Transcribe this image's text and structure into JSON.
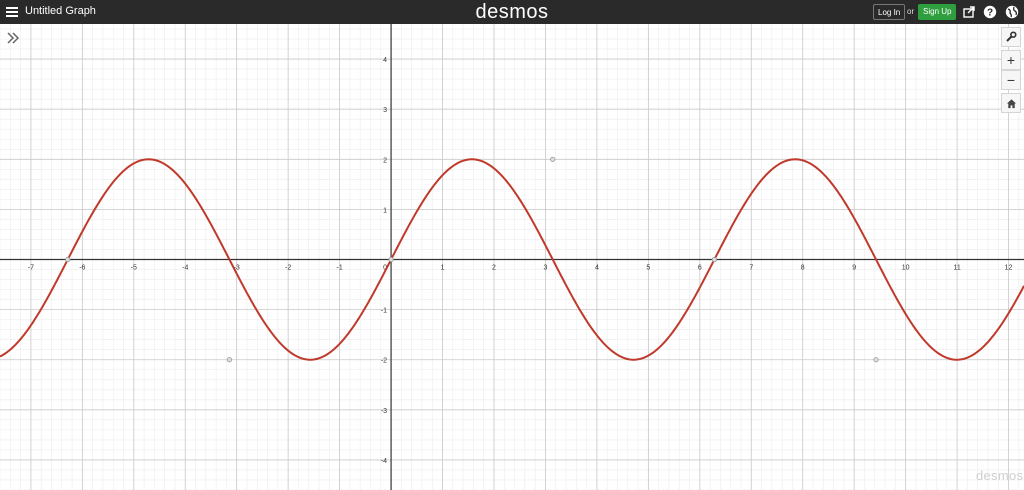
{
  "topbar": {
    "title": "Untitled Graph",
    "brand": "desmos",
    "login_label": "Log In",
    "or_label": "or",
    "signup_label": "Sign Up",
    "icons": [
      "share-icon",
      "help-icon",
      "globe-icon"
    ]
  },
  "toolbar": {
    "zoom_in_label": "+",
    "zoom_out_label": "−"
  },
  "graph": {
    "x_range": [
      -7.6,
      12.3
    ],
    "y_range": [
      -4.6,
      4.7
    ],
    "x_ticks": [
      -7,
      -6,
      -5,
      -4,
      -3,
      -2,
      -1,
      1,
      2,
      3,
      4,
      5,
      6,
      7,
      8,
      9,
      10,
      11,
      12
    ],
    "y_ticks": [
      -4,
      -3,
      -2,
      -1,
      1,
      2,
      3,
      4
    ],
    "curve": {
      "function": "2 sin(x)",
      "amplitude": 2,
      "color": "#c0392b"
    },
    "points": [
      {
        "x": -6.283,
        "y": 0
      },
      {
        "x": -3.1416,
        "y": -2
      },
      {
        "x": 0,
        "y": 0
      },
      {
        "x": 3.1416,
        "y": 2
      },
      {
        "x": 6.283,
        "y": 0
      },
      {
        "x": 9.4248,
        "y": -2
      }
    ]
  },
  "watermark": "desmos"
}
